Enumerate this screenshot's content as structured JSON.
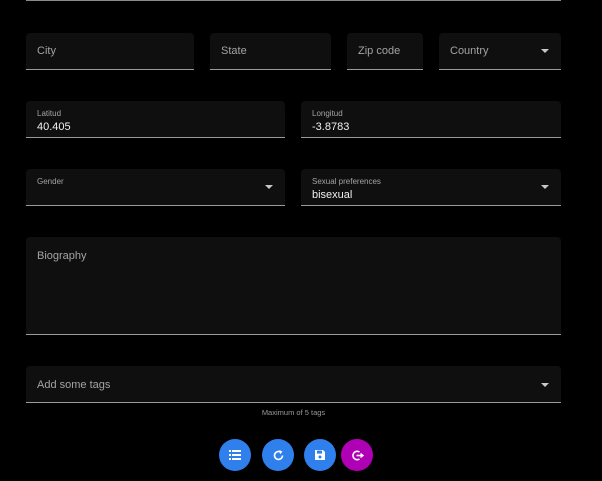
{
  "address": {
    "city": {
      "label": "City",
      "value": ""
    },
    "state": {
      "label": "State",
      "value": ""
    },
    "zip": {
      "label": "Zip code",
      "value": ""
    },
    "country": {
      "label": "Country",
      "value": ""
    }
  },
  "location": {
    "latitude": {
      "label": "Latitud",
      "value": "40.405"
    },
    "longitude": {
      "label": "Longitud",
      "value": "-3.8783"
    }
  },
  "profile": {
    "gender": {
      "label": "Gender",
      "value": ""
    },
    "sexual_preferences": {
      "label": "Sexual preferences",
      "value": "bisexual"
    },
    "biography": {
      "label": "Biography",
      "value": ""
    }
  },
  "tags": {
    "placeholder": "Add some tags",
    "hint": "Maximum of 5 tags"
  },
  "actions": [
    {
      "icon": "list-icon",
      "color": "#2f80ed"
    },
    {
      "icon": "refresh-icon",
      "color": "#2f80ed"
    },
    {
      "icon": "save-icon",
      "color": "#2f80ed"
    },
    {
      "icon": "logout-icon",
      "color": "#b000b5"
    }
  ],
  "colors": {
    "background": "#000000",
    "field_background": "#0f0f0f",
    "primary": "#2f80ed",
    "accent": "#b000b5"
  }
}
